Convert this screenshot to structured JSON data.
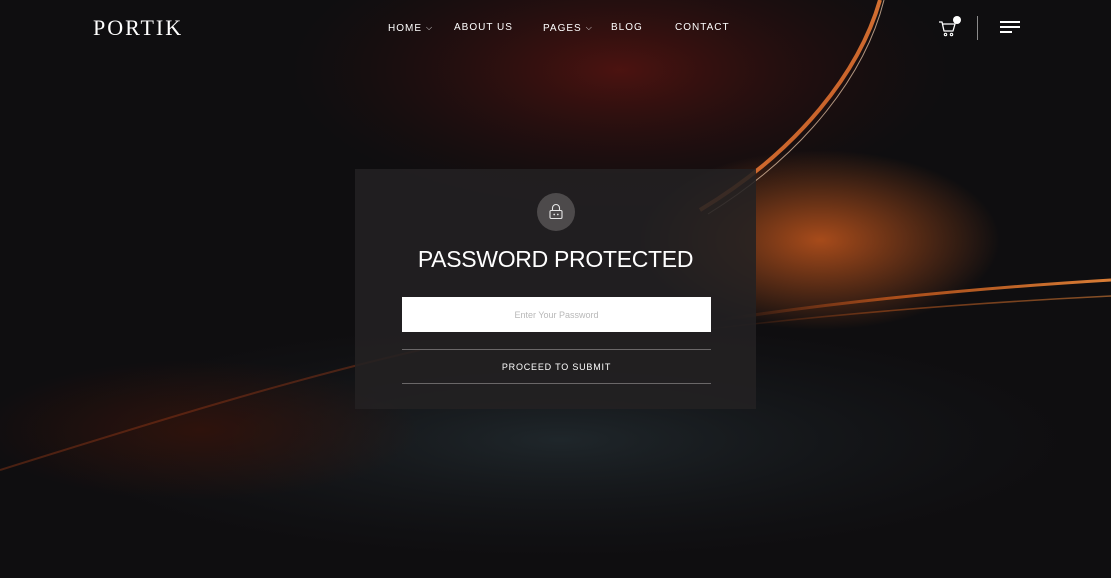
{
  "brand": {
    "logo_text": "PORTIK"
  },
  "nav": {
    "items": [
      {
        "label": "HOME",
        "has_dropdown": true
      },
      {
        "label": "ABOUT US",
        "has_dropdown": false
      },
      {
        "label": "PAGES",
        "has_dropdown": true
      },
      {
        "label": "BLOG",
        "has_dropdown": false
      },
      {
        "label": "CONTACT",
        "has_dropdown": false
      }
    ],
    "dropdown_glyph": "⌵"
  },
  "header_icons": {
    "cart": "cart-icon",
    "cart_badge": "cart-badge-dot",
    "menu": "hamburger-menu-icon"
  },
  "password_form": {
    "icon": "lock-icon",
    "title": "PASSWORD PROTECTED",
    "input_placeholder": "Enter Your Password",
    "input_value": "",
    "submit_label": "PROCEED TO SUBMIT"
  },
  "colors": {
    "background": "#0f0e10",
    "accent_glow": "#e5611f",
    "card_background": "#232122",
    "text": "#ffffff"
  }
}
